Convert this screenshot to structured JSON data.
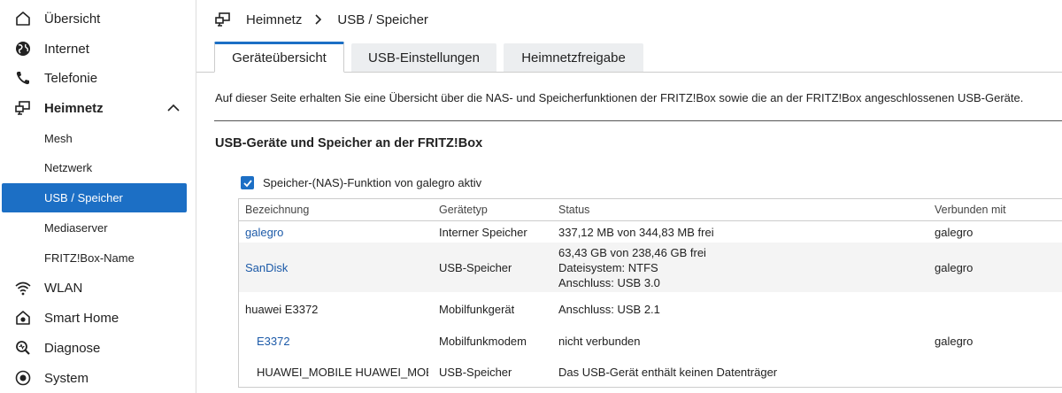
{
  "sidebar": {
    "items": [
      {
        "label": "Übersicht",
        "icon": "home-icon"
      },
      {
        "label": "Internet",
        "icon": "globe-icon"
      },
      {
        "label": "Telefonie",
        "icon": "phone-icon"
      },
      {
        "label": "Heimnetz",
        "icon": "network-icon",
        "expanded": true
      },
      {
        "label": "WLAN",
        "icon": "wifi-icon"
      },
      {
        "label": "Smart Home",
        "icon": "smart-home-icon"
      },
      {
        "label": "Diagnose",
        "icon": "diagnose-icon"
      },
      {
        "label": "System",
        "icon": "system-icon"
      }
    ],
    "sub_items": [
      "Mesh",
      "Netzwerk",
      "USB / Speicher",
      "Mediaserver",
      "FRITZ!Box-Name"
    ],
    "active_sub_item": "USB / Speicher"
  },
  "breadcrumb": {
    "parent": "Heimnetz",
    "current": "USB / Speicher"
  },
  "tabs": [
    "Geräteübersicht",
    "USB-Einstellungen",
    "Heimnetzfreigabe"
  ],
  "active_tab": "Geräteübersicht",
  "intro_text": "Auf dieser Seite erhalten Sie eine Übersicht über die NAS- und Speicherfunktionen der FRITZ!Box sowie die an der FRITZ!Box angeschlossenen USB-Geräte.",
  "section_title": "USB-Geräte und Speicher an der FRITZ!Box",
  "nas_checkbox": {
    "label": "Speicher-(NAS)-Funktion von galegro aktiv",
    "checked": true
  },
  "table": {
    "headers": [
      "Bezeichnung",
      "Gerätetyp",
      "Status",
      "Verbunden mit"
    ],
    "rows": [
      {
        "name": "galegro",
        "type": "Interner Speicher",
        "status": [
          "337,12 MB von 344,83 MB frei"
        ],
        "connected": "galegro"
      },
      {
        "name": "SanDisk",
        "type": "USB-Speicher",
        "status": [
          "63,43 GB von 238,46 GB frei",
          "Dateisystem: NTFS",
          "Anschluss: USB 3.0"
        ],
        "connected": "galegro"
      },
      {
        "name": "huawei E3372",
        "type": "Mobilfunkgerät",
        "status": [
          "Anschluss: USB 2.1"
        ],
        "connected": ""
      },
      {
        "name": "E3372",
        "type": "Mobilfunkmodem",
        "status": [
          "nicht verbunden"
        ],
        "connected": "galegro"
      },
      {
        "name": "HUAWEI_MOBILE HUAWEI_MOBILE",
        "type": "USB-Speicher",
        "status": [
          "Das USB-Gerät enthält keinen Datenträger"
        ],
        "connected": ""
      }
    ]
  },
  "colors": {
    "accent": "#1c6fc5",
    "link": "#1c5aa8"
  }
}
